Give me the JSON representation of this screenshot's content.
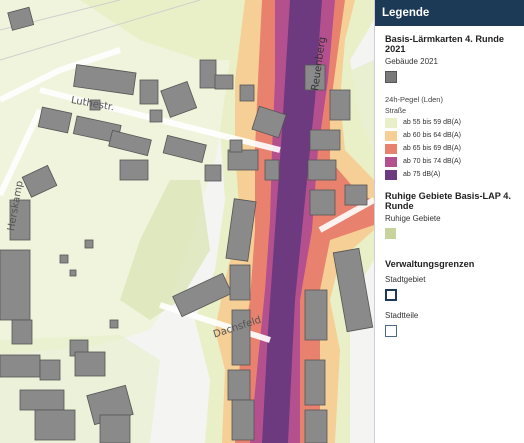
{
  "legend": {
    "header": "Legende",
    "section1_title": "Basis-Lärmkarten 4. Runde 2021",
    "buildings_label": "Gebäude 2021",
    "pegel_label": "24h-Pegel (Lden)",
    "street_label": "Straße",
    "noise_classes": [
      {
        "label": "ab 55 bis 59 dB(A)",
        "color": "#e9f0c8"
      },
      {
        "label": "ab 60 bis 64 dB(A)",
        "color": "#f5cf95"
      },
      {
        "label": "ab 65 bis 69 dB(A)",
        "color": "#e8826e"
      },
      {
        "label": "ab 70 bis 74 dB(A)",
        "color": "#b5508f"
      },
      {
        "label": "ab 75 dB(A)",
        "color": "#6d3a80"
      }
    ],
    "section2_title": "Ruhige Gebiete Basis-LAP 4. Runde",
    "quiet_label": "Ruhige Gebiete",
    "quiet_color": "#c8d39b",
    "section3_title": "Verwaltungsgrenzen",
    "stadtgebiet_label": "Stadtgebiet",
    "stadtteile_label": "Stadtteile"
  },
  "map": {
    "streets": [
      "Luthestr.",
      "Herskamp",
      "Reuenberg",
      "Dachsfeld"
    ]
  }
}
